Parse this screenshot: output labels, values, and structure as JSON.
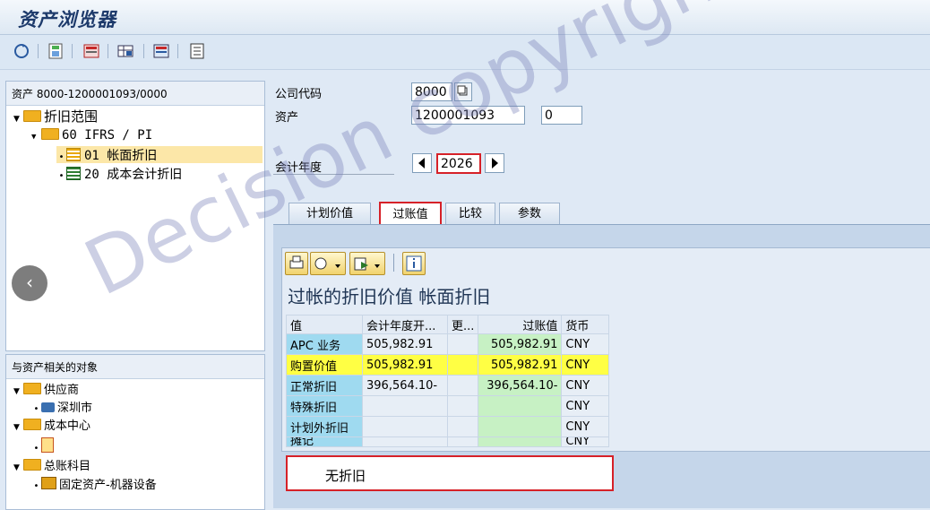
{
  "app": {
    "title": "资产浏览器"
  },
  "left_panel": {
    "header": "资产 8000-1200001093/0000",
    "tree": [
      {
        "label": "折旧范围"
      },
      {
        "label": "60 IFRS / PI"
      },
      {
        "label": "01 帐面折旧"
      },
      {
        "label": "20 成本会计折旧"
      }
    ]
  },
  "related_panel": {
    "header": "与资产相关的对象",
    "items": [
      {
        "label": "供应商"
      },
      {
        "label": "深圳市"
      },
      {
        "label": "成本中心"
      },
      {
        "label": "总账科目"
      },
      {
        "label": "固定资产-机器设备"
      }
    ]
  },
  "form": {
    "company_code_label": "公司代码",
    "company_code_value": "8000",
    "asset_label": "资产",
    "asset_value": "1200001093",
    "asset_sub_value": "0",
    "fiscal_year_label": "会计年度",
    "fiscal_year_value": "2026"
  },
  "tabs": [
    {
      "label": "计划价值"
    },
    {
      "label": "过账值"
    },
    {
      "label": "比较"
    },
    {
      "label": "参数"
    }
  ],
  "grid": {
    "title": "过帐的折旧价值 帐面折旧",
    "columns": [
      "值",
      "会计年度开...",
      "更...",
      "过账值",
      "货币"
    ],
    "rows": [
      {
        "name": "APC 业务",
        "start": "505,982.91",
        "change": "",
        "posted": "505,982.91",
        "currency": "CNY"
      },
      {
        "name": "购置价值",
        "start": "505,982.91",
        "change": "",
        "posted": "505,982.91",
        "currency": "CNY"
      },
      {
        "name": "正常折旧",
        "start": "396,564.10-",
        "change": "",
        "posted": "396,564.10-",
        "currency": "CNY"
      },
      {
        "name": "特殊折旧",
        "start": "",
        "change": "",
        "posted": "",
        "currency": "CNY"
      },
      {
        "name": "计划外折旧",
        "start": "",
        "change": "",
        "posted": "",
        "currency": "CNY"
      },
      {
        "name": "摊记",
        "start": "",
        "change": "",
        "posted": "",
        "currency": "CNY"
      }
    ]
  },
  "message": {
    "text": "无折旧"
  },
  "watermark": {
    "text": "Decision copyright"
  },
  "colors": {
    "accent_red": "#d62128",
    "highlight_yellow": "#ffff44",
    "posted_green": "#c7f1c4"
  }
}
